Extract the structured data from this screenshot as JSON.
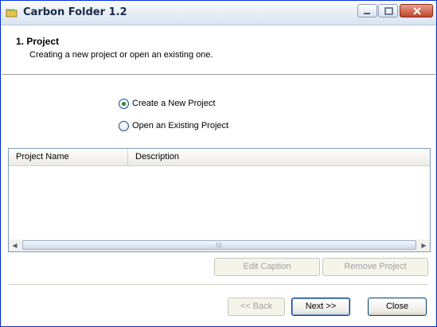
{
  "window": {
    "title": "Carbon Folder 1.2",
    "icon": "folder-icon"
  },
  "titlebar": {
    "minimize_icon": "minimize-icon",
    "maximize_icon": "maximize-icon",
    "close_icon": "close-icon"
  },
  "header": {
    "title": "1. Project",
    "subtitle": "Creating a new project or open an existing one."
  },
  "options": {
    "create_new": {
      "label": "Create a New Project",
      "selected": true
    },
    "open_existing": {
      "label": "Open an Existing Project",
      "selected": false
    }
  },
  "project_list": {
    "columns": [
      "Project Name",
      "Description"
    ],
    "rows": []
  },
  "list_buttons": {
    "edit_caption": "Edit Caption",
    "remove_project": "Remove Project"
  },
  "nav_buttons": {
    "back": "<< Back",
    "next": "Next >>",
    "close": "Close"
  },
  "colors": {
    "title_bar_border": "#0831d9",
    "selected_radio": "#2a8a32",
    "disabled_text": "#a0a0a0"
  }
}
